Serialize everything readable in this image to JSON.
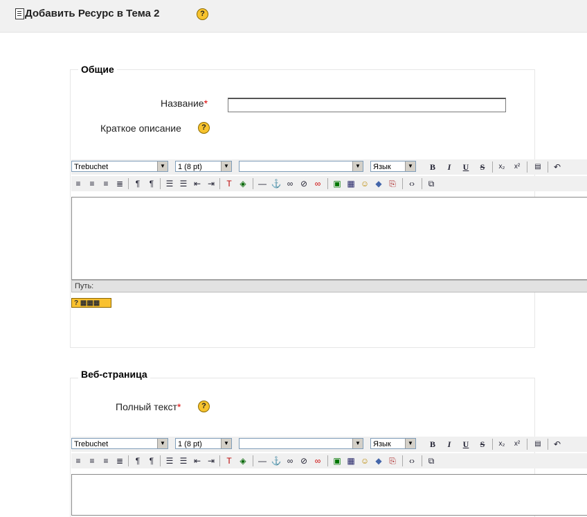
{
  "header": {
    "title": "Добавить Ресурс в Тема 2",
    "help": "?"
  },
  "general": {
    "legend": "Общие",
    "name_label": "Название",
    "required_mark": "*",
    "name_value": "",
    "summary_label": "Краткое описание",
    "help": "?"
  },
  "editor_toolbar": {
    "font_family": "Trebuchet",
    "font_size": "1 (8 pt)",
    "format": "",
    "language": "Язык",
    "dropdown_arrow": "▼",
    "bold": "B",
    "italic": "I",
    "underline": "U",
    "strike": "S",
    "subscript": "x₂",
    "superscript": "x²"
  },
  "editor1": {
    "path_label": "Путь:",
    "kbd_help": "? ▦▦▦"
  },
  "webpage": {
    "legend": "Веб-страница",
    "fulltext_label": "Полный текст",
    "required_mark": "*",
    "help": "?"
  },
  "colors": {
    "accent_help": "#f7c32e",
    "required": "#dd0000",
    "header_bg": "#f1f1f1"
  }
}
